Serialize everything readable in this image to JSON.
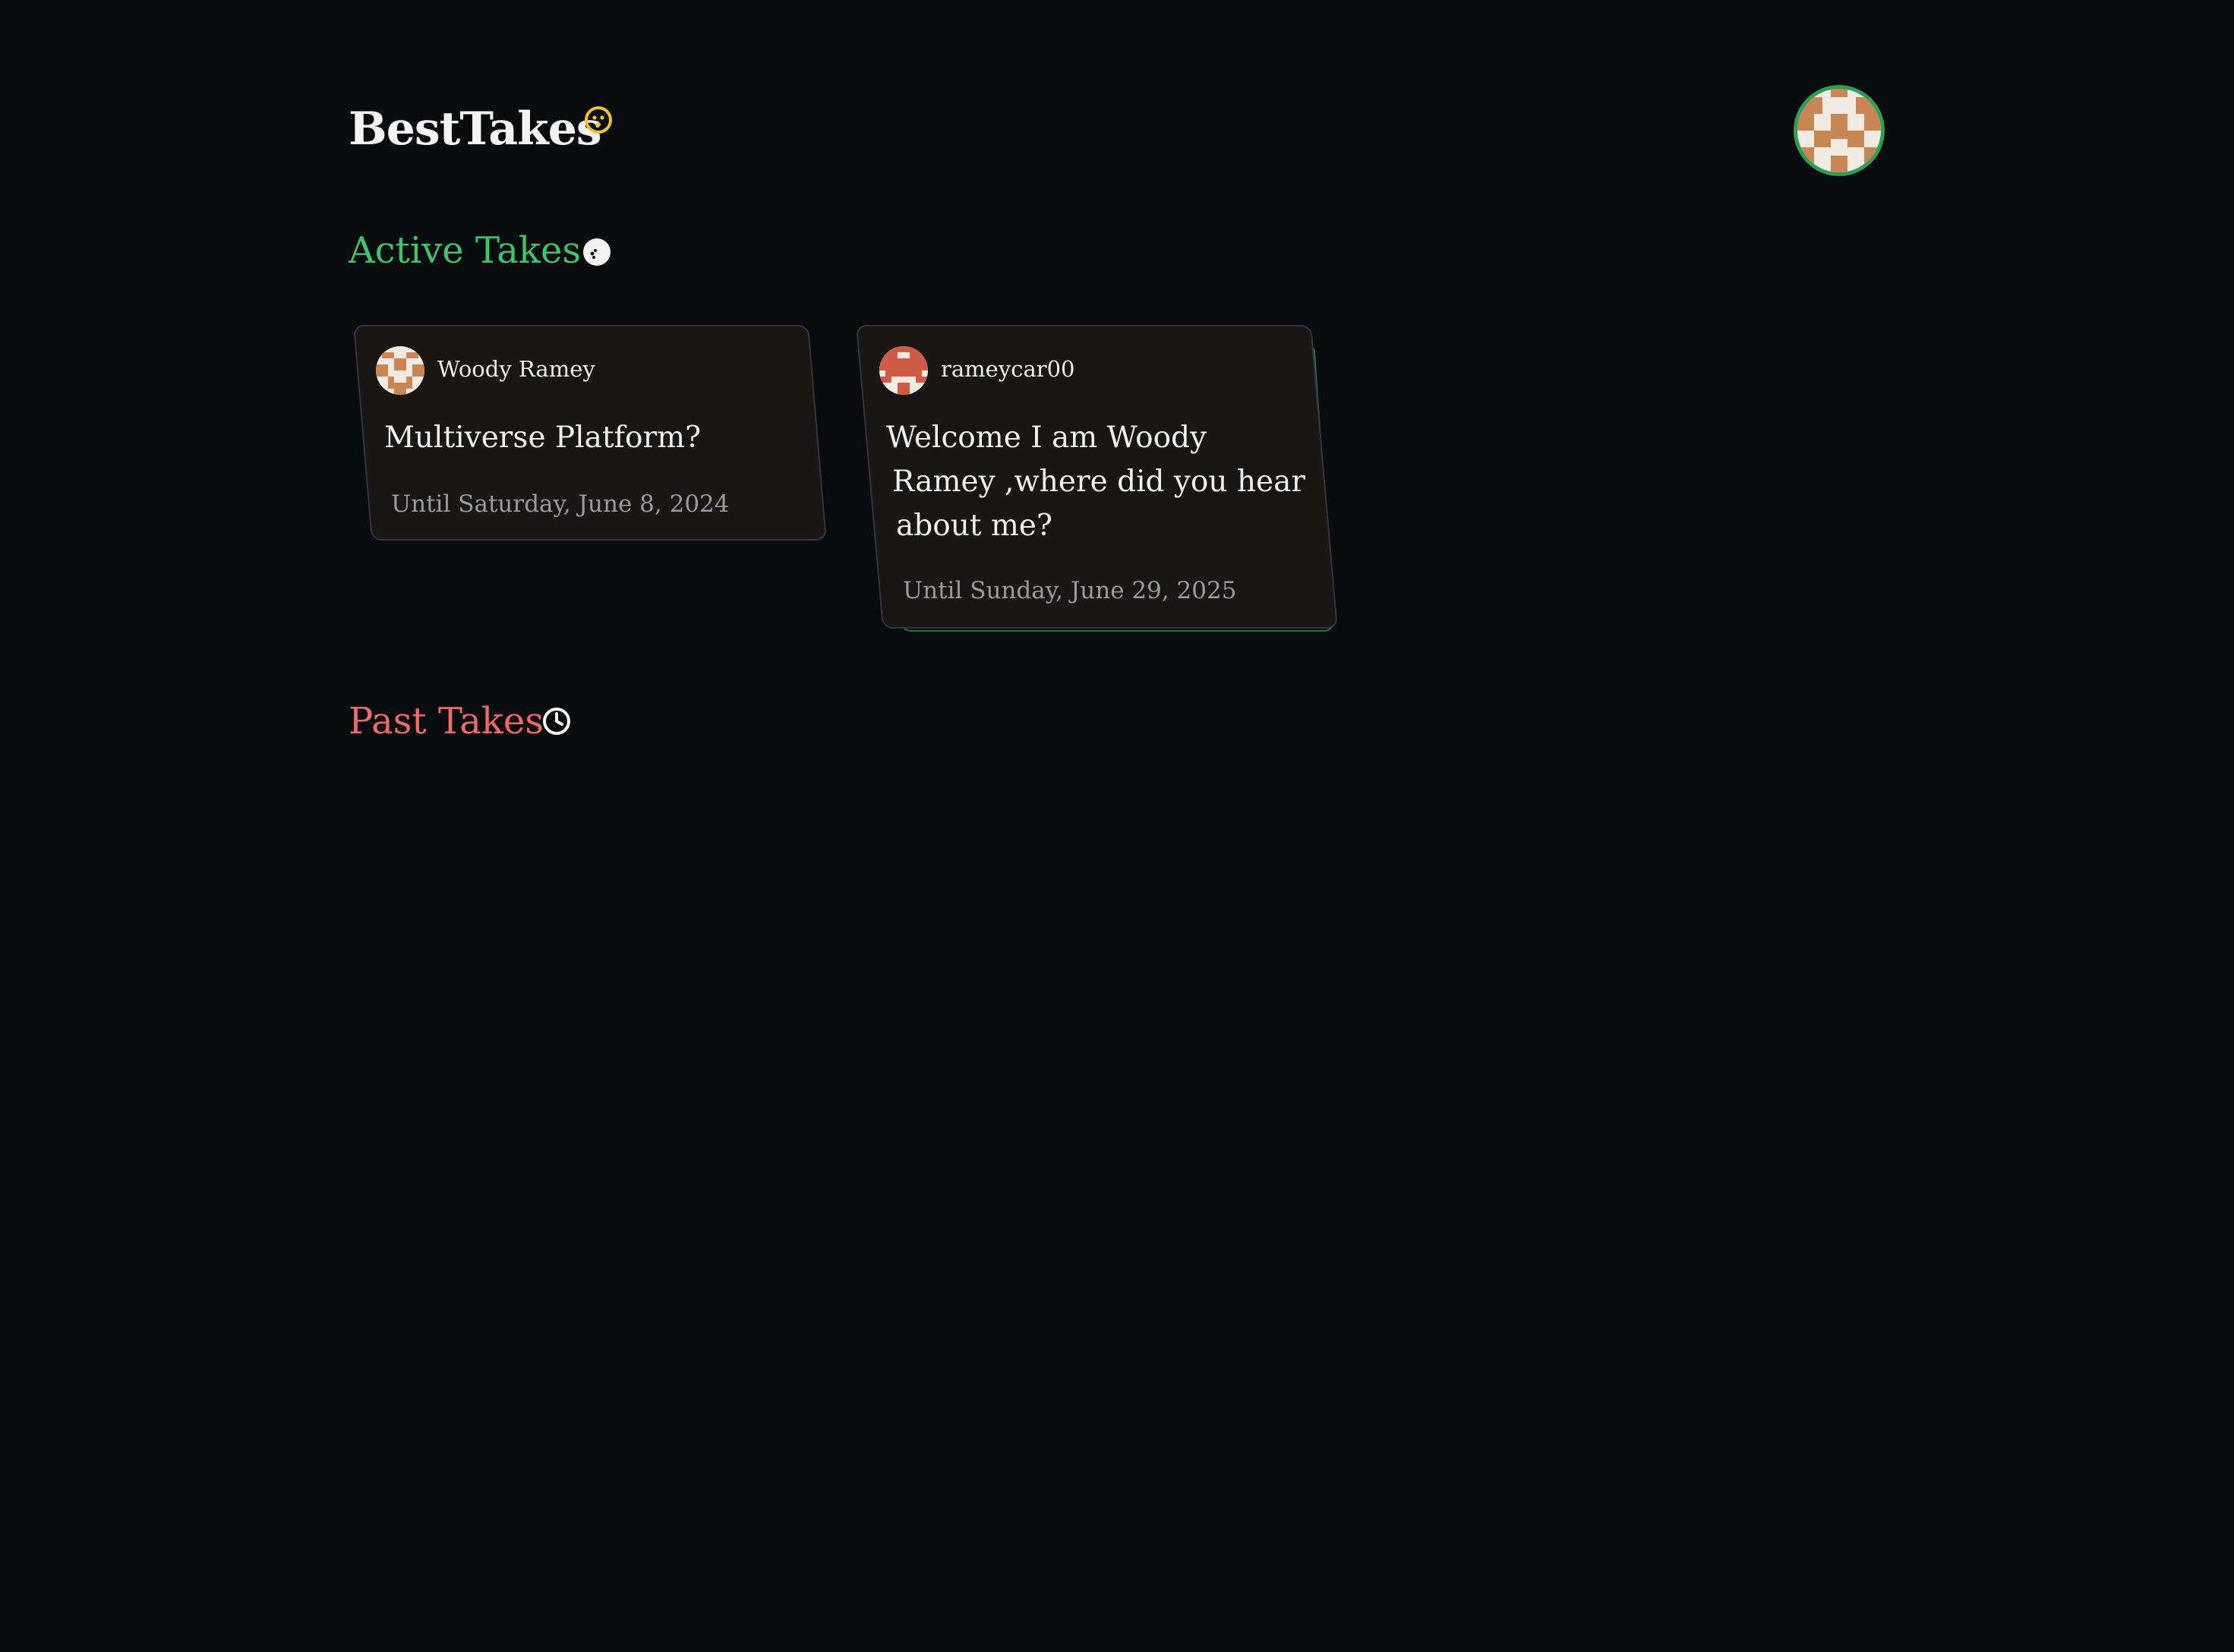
{
  "app": {
    "title": "BestTakes"
  },
  "sections": {
    "active": {
      "label": "Active Takes"
    },
    "past": {
      "label": "Past Takes"
    }
  },
  "colors": {
    "background": "#0a0b0d",
    "active_accent": "#3ec46f",
    "past_accent": "#ee6b6b",
    "title_icon": "#f2c230",
    "card_background": "#181716",
    "card_shadow_border": "#1f7a41"
  },
  "icons": {
    "title": "smiley-face-icon",
    "active": "dots-circle-icon",
    "past": "clock-icon",
    "profile": "user-avatar"
  },
  "takes": [
    {
      "author": "Woody Ramey",
      "title": "Multiverse Platform?",
      "until": "Until Saturday, June 8, 2024"
    },
    {
      "author": "rameycar00",
      "title_lines": [
        "Welcome I am Woody",
        "Ramey ,where did you hear",
        "about me?"
      ],
      "until": "Until Sunday, June 29, 2025"
    }
  ]
}
